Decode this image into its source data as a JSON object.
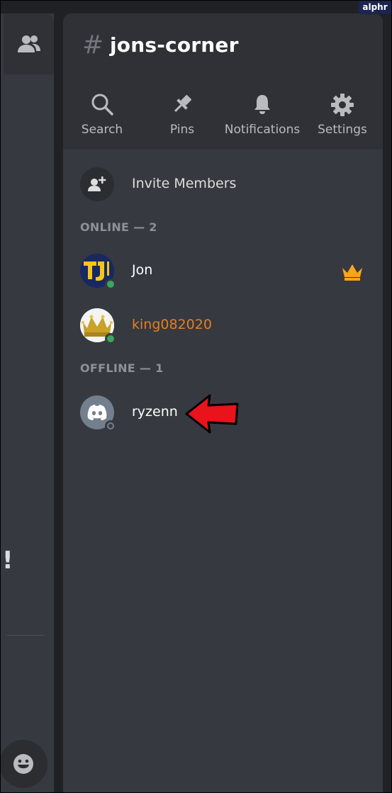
{
  "channel": {
    "hash": "#",
    "name": "jons-corner"
  },
  "toolbar": {
    "search_label": "Search",
    "pins_label": "Pins",
    "notifications_label": "Notifications",
    "settings_label": "Settings"
  },
  "invite": {
    "label": "Invite Members"
  },
  "sections": {
    "online": "ONLINE — 2",
    "offline": "OFFLINE — 1"
  },
  "members": [
    {
      "name": "Jon",
      "status": "online",
      "owner": true,
      "name_color": "#ffffff"
    },
    {
      "name": "king082020",
      "status": "online",
      "owner": false,
      "name_color": "#e67e22"
    },
    {
      "name": "ryzenn",
      "status": "offline",
      "owner": false,
      "name_color": "#ffffff"
    }
  ],
  "left_panel": {
    "partial_text": "!"
  },
  "watermark": "alphr",
  "colors": {
    "online": "#3ba55d",
    "offline": "#747f8d",
    "owner_crown": "#faa61a",
    "arrow": "#e8131b"
  }
}
